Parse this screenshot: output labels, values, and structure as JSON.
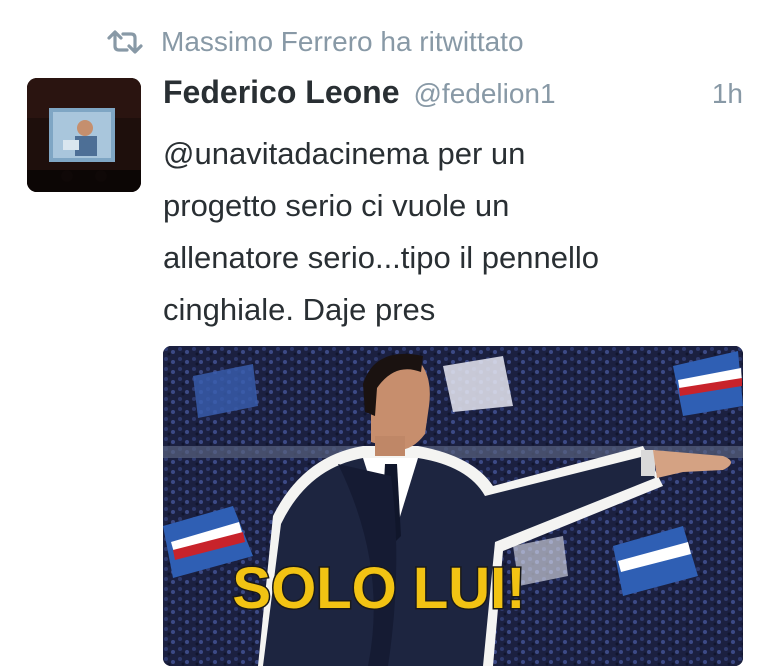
{
  "retweet": {
    "icon": "retweet-icon",
    "text": "Massimo Ferrero ha ritwittato"
  },
  "tweet": {
    "display_name": "Federico Leone",
    "handle": "@fedelion1",
    "time": "1h",
    "text_lines": [
      "@unavitadacinema per un",
      "progetto serio ci vuole un",
      "allenatore serio...tipo il pennello",
      "cinghiale. Daje pres"
    ],
    "media": {
      "caption": "SOLO LUI!"
    }
  },
  "colors": {
    "muted": "#8899a6",
    "text": "#292f33",
    "caption_fill": "#f2c313"
  }
}
